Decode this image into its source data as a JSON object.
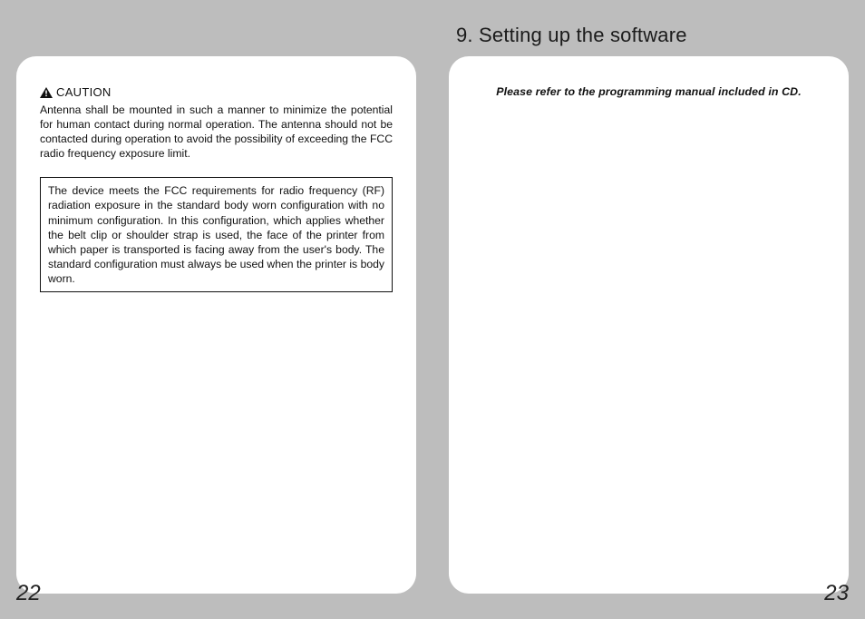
{
  "left": {
    "caution_label": "CAUTION",
    "caution_body": "Antenna shall be mounted in such a manner to minimize the potential for human contact during normal operation. The antenna should not be contacted during operation to avoid the possibility of exceeding the FCC radio frequency exposure limit.",
    "fcc_box": "The device meets the FCC requirements for radio frequency (RF) radiation exposure in the standard body worn configuration with no minimum configuration. In this configuration, which applies whether the belt clip or shoulder strap is used, the face of the printer from which paper is transported is facing away from the user's body. The standard configuration must always be used when the printer is body worn.",
    "page_number": "22"
  },
  "right": {
    "heading": "9. Setting up the software",
    "note": "Please refer to the programming manual included in CD.",
    "page_number": "23"
  }
}
